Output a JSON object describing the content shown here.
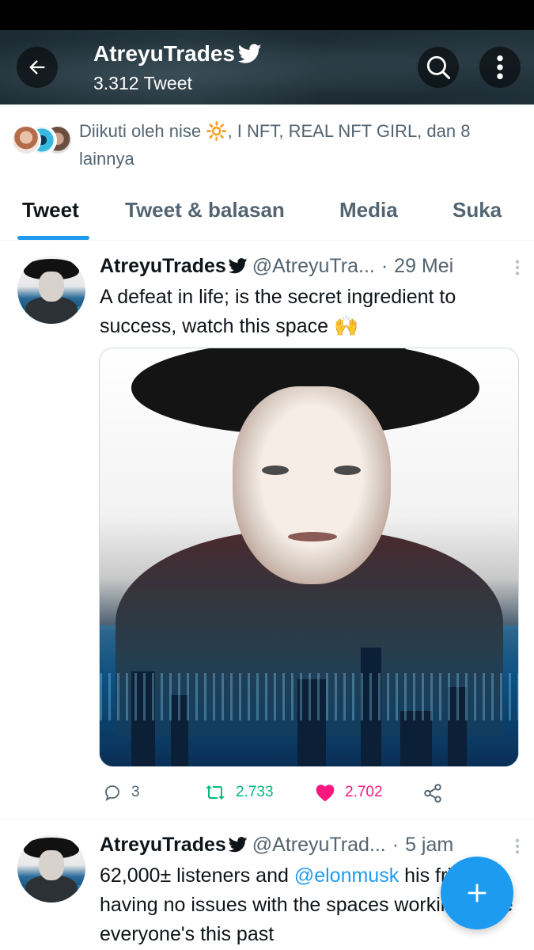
{
  "header": {
    "name": "AtreyuTrades",
    "tweet_count": "3.312 Tweet"
  },
  "followed": {
    "text": "Diikuti oleh nise 🔆, I NFT, REAL NFT GIRL, dan 8 lainnya"
  },
  "tabs": [
    {
      "label": "Tweet",
      "active": true
    },
    {
      "label": "Tweet & balasan",
      "active": false
    },
    {
      "label": "Media",
      "active": false
    },
    {
      "label": "Suka",
      "active": false
    }
  ],
  "tweets": [
    {
      "name": "AtreyuTrades",
      "handle": "@AtreyuTra...",
      "dot": "·",
      "time": "29 Mei",
      "text": "A defeat in life; is the secret ingredient to success, watch this space 🙌",
      "replies": "3",
      "retweets": "2.733",
      "likes": "2.702"
    },
    {
      "name": "AtreyuTrades",
      "handle": "@AtreyuTrad...",
      "dot": "·",
      "time": "5 jam",
      "text_before": "62,000± listeners and ",
      "mention": "@elonmusk",
      "text_after": " his friends having no issues with the spaces working while everyone's this past"
    }
  ],
  "colors": {
    "accent": "#1d9bf0",
    "retweet": "#00ba7c",
    "like": "#f91880",
    "muted": "#536471"
  },
  "icons": [
    "back-arrow-icon",
    "search-icon",
    "more-vertical-icon",
    "verified-bird-icon",
    "reply-icon",
    "retweet-icon",
    "heart-icon",
    "share-icon",
    "plus-icon"
  ]
}
